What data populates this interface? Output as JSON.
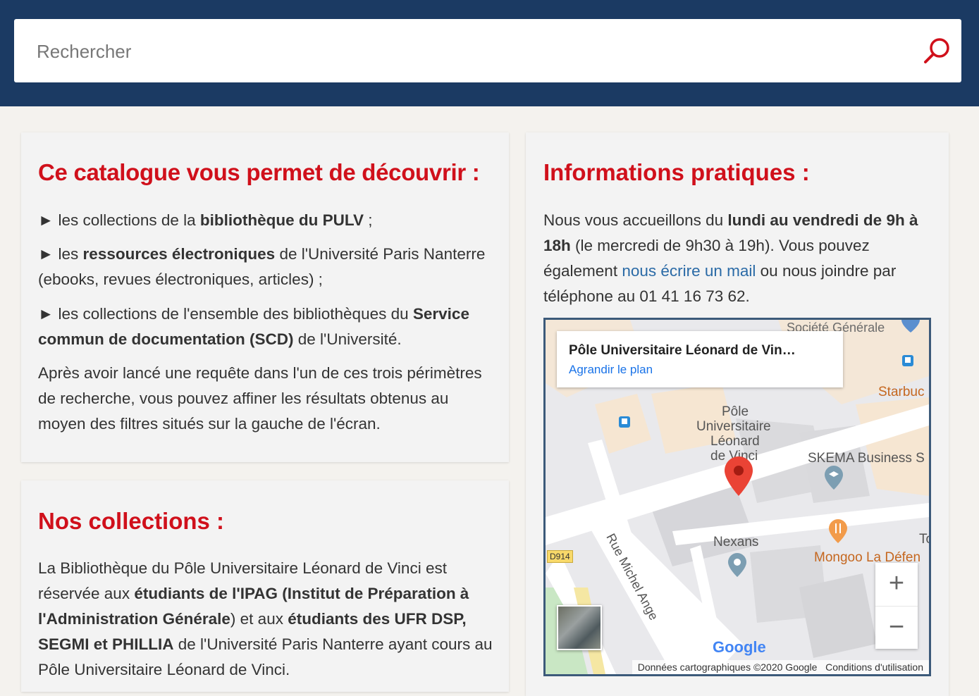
{
  "search": {
    "placeholder": "Rechercher"
  },
  "catalogue": {
    "title": "Ce catalogue vous permet de découvrir :",
    "item1": {
      "prefix": "► les collections de la ",
      "bold": "bibliothèque du PULV",
      "suffix": " ;"
    },
    "item2": {
      "prefix": "► les ",
      "bold": "ressources électroniques",
      "suffix": " de l'Université Paris Nanterre",
      "line2": "(ebooks, revues électroniques, articles) ;"
    },
    "item3": {
      "prefix": "► les collections de l'ensemble des bibliothèques du ",
      "bold1": "Service",
      "bold2": "commun de documentation (SCD)",
      "suffix": " de l'Université."
    },
    "para": {
      "line1": "Après avoir lancé une requête dans l'un de ces trois périmètres",
      "line2": "de recherche, vous pouvez affiner les résultats obtenus au",
      "line3": "moyen des filtres situés sur la gauche de l'écran."
    }
  },
  "collections": {
    "title": "Nos collections :",
    "line1": "La Bibliothèque du Pôle Universitaire Léonard de Vinci est",
    "line2_prefix": "réservée aux ",
    "line2_bold": "étudiants de l'IPAG (Institut de Préparation à",
    "line3_bold": "l'Administration Générale",
    "line3_mid": ") et aux ",
    "line3_bold2": "étudiants des UFR DSP,",
    "line4_bold": "SEGMI et PHILLIA",
    "line4_suffix": " de l'Université Paris Nanterre ayant cours au",
    "line5": "Pôle Universitaire Léonard de Vinci."
  },
  "infos": {
    "title": "Informations pratiques :",
    "line1_prefix": "Nous vous accueillons du ",
    "line1_bold": "lundi au vendredi de 9h à",
    "line2_bold": "18h",
    "line2_suffix": " (le mercredi de 9h30 à 19h). Vous pouvez",
    "line3_prefix": "également ",
    "line3_link": "nous écrire un mail",
    "line3_suffix": " ou nous joindre par",
    "line4": "téléphone au 01 41 16 73 62."
  },
  "map": {
    "place_title": "Pôle Universitaire Léonard de Vin…",
    "enlarge_link": "Agrandir le plan",
    "labels": {
      "societe": "Société Générale",
      "starbucks": "Starbuc",
      "pole1": "Pôle",
      "pole2": "Universitaire",
      "pole3": "Léonard",
      "pole4": "de Vinci",
      "skema": "SKEMA Business S",
      "nexans": "Nexans",
      "mongoo": "Mongoo La Défen",
      "to": "To",
      "road": "D914",
      "street": "Rue Michel Ange"
    },
    "zoom_in": "+",
    "zoom_out": "−",
    "google": "Google",
    "attribution": "Données cartographiques ©2020 Google",
    "terms": "Conditions d'utilisation"
  }
}
